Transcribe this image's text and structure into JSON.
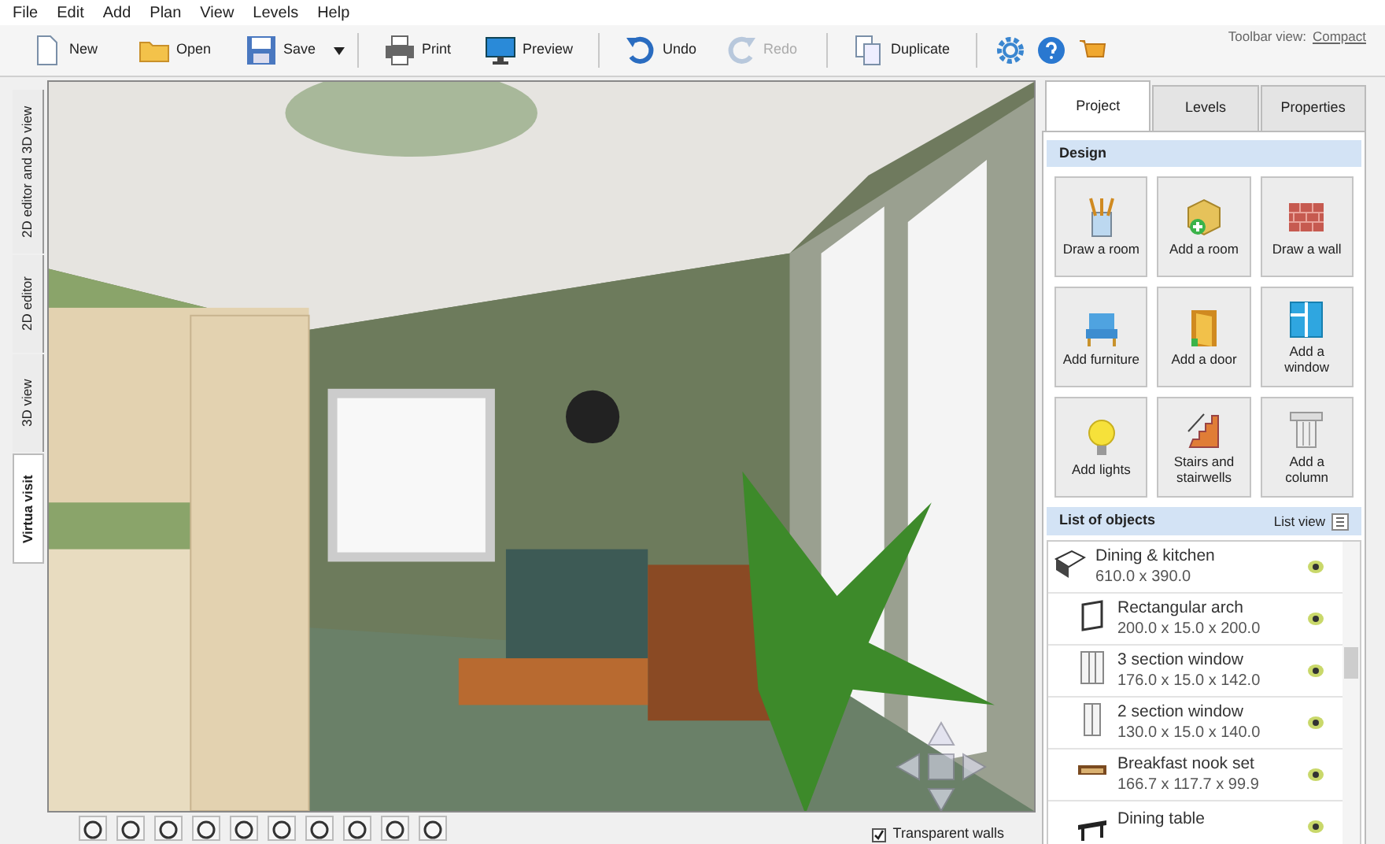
{
  "menu": [
    "File",
    "Edit",
    "Add",
    "Plan",
    "View",
    "Levels",
    "Help"
  ],
  "toolbar": {
    "buttons": [
      {
        "kind": "new",
        "label": "New",
        "disabled": false
      },
      {
        "kind": "open",
        "label": "Open",
        "disabled": false
      },
      {
        "kind": "save",
        "label": "Save",
        "disabled": false
      },
      {
        "kind": "print",
        "label": "Print",
        "disabled": false
      },
      {
        "kind": "preview",
        "label": "Preview",
        "disabled": false
      },
      {
        "kind": "undo",
        "label": "Undo",
        "disabled": false
      },
      {
        "kind": "redo",
        "label": "Redo",
        "disabled": true
      },
      {
        "kind": "duplicate",
        "label": "Duplicate",
        "disabled": false
      }
    ],
    "view_label": "Toolbar view:",
    "view_link": "Compact"
  },
  "view_tabs": [
    {
      "label": "2D editor and 3D view",
      "selected": false
    },
    {
      "label": "2D editor",
      "selected": false
    },
    {
      "label": "3D view",
      "selected": false
    },
    {
      "label": "Virtua visit",
      "selected": true
    }
  ],
  "transparent_walls": {
    "label": "Transparent walls",
    "checked": true
  },
  "panel": {
    "tabs": [
      {
        "label": "Project",
        "selected": true
      },
      {
        "label": "Levels",
        "selected": false
      },
      {
        "label": "Properties",
        "selected": false
      }
    ],
    "design_title": "Design",
    "design_buttons": [
      {
        "kind": "draw-room",
        "label": "Draw a room"
      },
      {
        "kind": "add-room",
        "label": "Add a room"
      },
      {
        "kind": "wall",
        "label": "Draw a wall"
      },
      {
        "kind": "furniture",
        "label": "Add furniture"
      },
      {
        "kind": "door",
        "label": "Add a door"
      },
      {
        "kind": "window",
        "label": "Add a window"
      },
      {
        "kind": "lights",
        "label": "Add lights"
      },
      {
        "kind": "stairs",
        "label": "Stairs and stairwells"
      },
      {
        "kind": "column",
        "label": "Add a column"
      }
    ],
    "list_title": "List of objects",
    "list_view": "List view",
    "objects": [
      {
        "kind": "room",
        "name": "Dining & kitchen",
        "size": "610.0 x 390.0",
        "children": [
          {
            "kind": "arch",
            "name": "Rectangular arch",
            "size": "200.0 x 15.0 x 200.0"
          },
          {
            "kind": "window3",
            "name": "3 section window",
            "size": "176.0 x 15.0 x 142.0"
          },
          {
            "kind": "window2",
            "name": "2 section window",
            "size": "130.0 x 15.0 x 140.0"
          },
          {
            "kind": "furniture",
            "name": "Breakfast nook set",
            "size": "166.7 x 117.7 x 99.9"
          },
          {
            "kind": "table",
            "name": "Dining table"
          }
        ]
      }
    ]
  }
}
